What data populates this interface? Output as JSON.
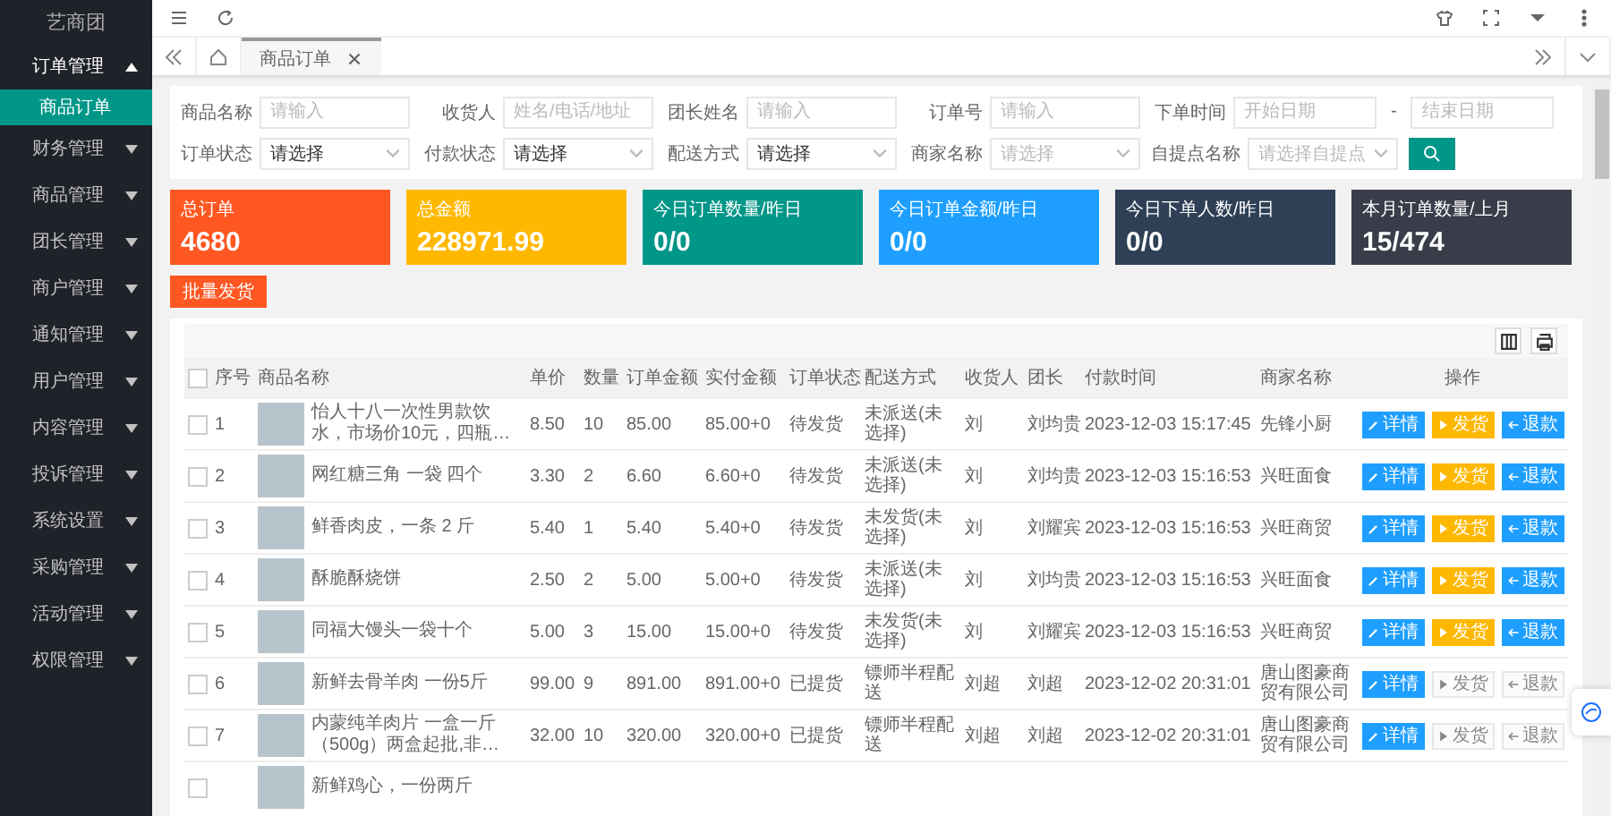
{
  "sidebar": {
    "logo": "艺商团",
    "items": [
      {
        "label": "订单管理",
        "expanded": true,
        "children": [
          {
            "label": "商品订单",
            "selected": true
          }
        ]
      },
      {
        "label": "财务管理",
        "expanded": false
      },
      {
        "label": "商品管理",
        "expanded": false
      },
      {
        "label": "团长管理",
        "expanded": false
      },
      {
        "label": "商户管理",
        "expanded": false
      },
      {
        "label": "通知管理",
        "expanded": false
      },
      {
        "label": "用户管理",
        "expanded": false
      },
      {
        "label": "内容管理",
        "expanded": false
      },
      {
        "label": "投诉管理",
        "expanded": false
      },
      {
        "label": "系统设置",
        "expanded": false
      },
      {
        "label": "采购管理",
        "expanded": false
      },
      {
        "label": "活动管理",
        "expanded": false
      },
      {
        "label": "权限管理",
        "expanded": false
      }
    ]
  },
  "tabs": [
    {
      "label": "商品订单",
      "selected": true
    }
  ],
  "filters": [
    [
      {
        "kind": "input",
        "label": "商品名称",
        "placeholder": "请输入"
      },
      {
        "kind": "input",
        "label": "收货人",
        "placeholder": "姓名/电话/地址"
      },
      {
        "kind": "input",
        "label": "团长姓名",
        "placeholder": "请输入"
      },
      {
        "kind": "input",
        "label": "订单号",
        "placeholder": "请输入"
      },
      {
        "kind": "daterange",
        "label": "下单时间",
        "placeholder": "开始日期",
        "separator": "-",
        "placeholder_end": "结束日期"
      }
    ],
    [
      {
        "kind": "select",
        "label": "订单状态",
        "value": "请选择"
      },
      {
        "kind": "select",
        "label": "付款状态",
        "value": "请选择"
      },
      {
        "kind": "select",
        "label": "配送方式",
        "value": "请选择"
      },
      {
        "kind": "select",
        "label": "商家名称",
        "placeholder": "请选择"
      },
      {
        "kind": "select",
        "label": "自提点名称",
        "placeholder": "请选择自提点"
      }
    ]
  ],
  "stats": [
    {
      "label": "总订单",
      "value": "4680",
      "color": "#ff5722"
    },
    {
      "label": "总金额",
      "value": "228971.99",
      "color": "#ffb800"
    },
    {
      "label": "今日订单数量/昨日",
      "value": "0/0",
      "color": "#009688"
    },
    {
      "label": "今日订单金额/昨日",
      "value": "0/0",
      "color": "#1e9fff"
    },
    {
      "label": "今日下单人数/昨日",
      "value": "0/0",
      "color": "#2f4056"
    },
    {
      "label": "本月订单数量/上月",
      "value": "15/474",
      "color": "#393d49"
    }
  ],
  "batch_button": "批量发货",
  "table": {
    "header_checked": false,
    "columns": [
      "序号",
      "商品名称",
      "单价",
      "数量",
      "订单金额",
      "实付金额",
      "订单状态",
      "配送方式",
      "收货人",
      "团长",
      "付款时间",
      "商家名称",
      "操作"
    ],
    "rows": [
      {
        "checked": false,
        "no": "1",
        "product": "怡人十八一次性男款饮水，市场价10元，四瓶…",
        "price": "8.50",
        "qty": "10",
        "amount": "85.00",
        "paid": "85.00+0",
        "status": "待发货",
        "delivery": "未派送(未选择)",
        "receiver": "刘",
        "leader": "刘均贵",
        "pay_time": "2023-12-03 15:17:45",
        "merchant": "先锋小厨",
        "actions": [
          {
            "kind": "detail",
            "label": "详情",
            "disabled": false
          },
          {
            "kind": "ship",
            "label": "发货",
            "disabled": false
          },
          {
            "kind": "refund",
            "label": "退款",
            "disabled": false
          }
        ]
      },
      {
        "checked": false,
        "no": "2",
        "product": "网红糖三角 一袋 四个",
        "price": "3.30",
        "qty": "2",
        "amount": "6.60",
        "paid": "6.60+0",
        "status": "待发货",
        "delivery": "未派送(未选择)",
        "receiver": "刘",
        "leader": "刘均贵",
        "pay_time": "2023-12-03 15:16:53",
        "merchant": "兴旺面食",
        "actions": [
          {
            "kind": "detail",
            "label": "详情",
            "disabled": false
          },
          {
            "kind": "ship",
            "label": "发货",
            "disabled": false
          },
          {
            "kind": "refund",
            "label": "退款",
            "disabled": false
          }
        ]
      },
      {
        "checked": false,
        "no": "3",
        "product": "鲜香肉皮，一条 2 斤",
        "price": "5.40",
        "qty": "1",
        "amount": "5.40",
        "paid": "5.40+0",
        "status": "待发货",
        "delivery": "未发货(未选择)",
        "receiver": "刘",
        "leader": "刘耀宾",
        "pay_time": "2023-12-03 15:16:53",
        "merchant": "兴旺商贸",
        "actions": [
          {
            "kind": "detail",
            "label": "详情",
            "disabled": false
          },
          {
            "kind": "ship",
            "label": "发货",
            "disabled": false
          },
          {
            "kind": "refund",
            "label": "退款",
            "disabled": false
          }
        ]
      },
      {
        "checked": false,
        "no": "4",
        "product": "酥脆酥烧饼",
        "price": "2.50",
        "qty": "2",
        "amount": "5.00",
        "paid": "5.00+0",
        "status": "待发货",
        "delivery": "未派送(未选择)",
        "receiver": "刘",
        "leader": "刘均贵",
        "pay_time": "2023-12-03 15:16:53",
        "merchant": "兴旺面食",
        "actions": [
          {
            "kind": "detail",
            "label": "详情",
            "disabled": false
          },
          {
            "kind": "ship",
            "label": "发货",
            "disabled": false
          },
          {
            "kind": "refund",
            "label": "退款",
            "disabled": false
          }
        ]
      },
      {
        "checked": false,
        "no": "5",
        "product": "同福大馒头一袋十个",
        "price": "5.00",
        "qty": "3",
        "amount": "15.00",
        "paid": "15.00+0",
        "status": "待发货",
        "delivery": "未发货(未选择)",
        "receiver": "刘",
        "leader": "刘耀宾",
        "pay_time": "2023-12-03 15:16:53",
        "merchant": "兴旺商贸",
        "actions": [
          {
            "kind": "detail",
            "label": "详情",
            "disabled": false
          },
          {
            "kind": "ship",
            "label": "发货",
            "disabled": false
          },
          {
            "kind": "refund",
            "label": "退款",
            "disabled": false
          }
        ]
      },
      {
        "checked": false,
        "no": "6",
        "product": "新鲜去骨羊肉 一份5斤",
        "price": "99.00",
        "qty": "9",
        "amount": "891.00",
        "paid": "891.00+0",
        "status": "已提货",
        "delivery": "镖师半程配送",
        "receiver": "刘超",
        "leader": "刘超",
        "pay_time": "2023-12-02 20:31:01",
        "merchant": "唐山图豪商贸有限公司",
        "actions": [
          {
            "kind": "detail",
            "label": "详情",
            "disabled": false
          },
          {
            "kind": "ship",
            "label": "发货",
            "disabled": true
          },
          {
            "kind": "refund",
            "label": "退款",
            "disabled": true
          }
        ]
      },
      {
        "checked": false,
        "no": "7",
        "product": "内蒙纯羊肉片 一盒一斤（500g）两盒起批,非…",
        "price": "32.00",
        "qty": "10",
        "amount": "320.00",
        "paid": "320.00+0",
        "status": "已提货",
        "delivery": "镖师半程配送",
        "receiver": "刘超",
        "leader": "刘超",
        "pay_time": "2023-12-02 20:31:01",
        "merchant": "唐山图豪商贸有限公司",
        "actions": [
          {
            "kind": "detail",
            "label": "详情",
            "disabled": false
          },
          {
            "kind": "ship",
            "label": "发货",
            "disabled": true
          },
          {
            "kind": "refund",
            "label": "退款",
            "disabled": true
          }
        ]
      },
      {
        "checked": false,
        "product": "新鲜鸡心，一份两斤"
      }
    ]
  }
}
